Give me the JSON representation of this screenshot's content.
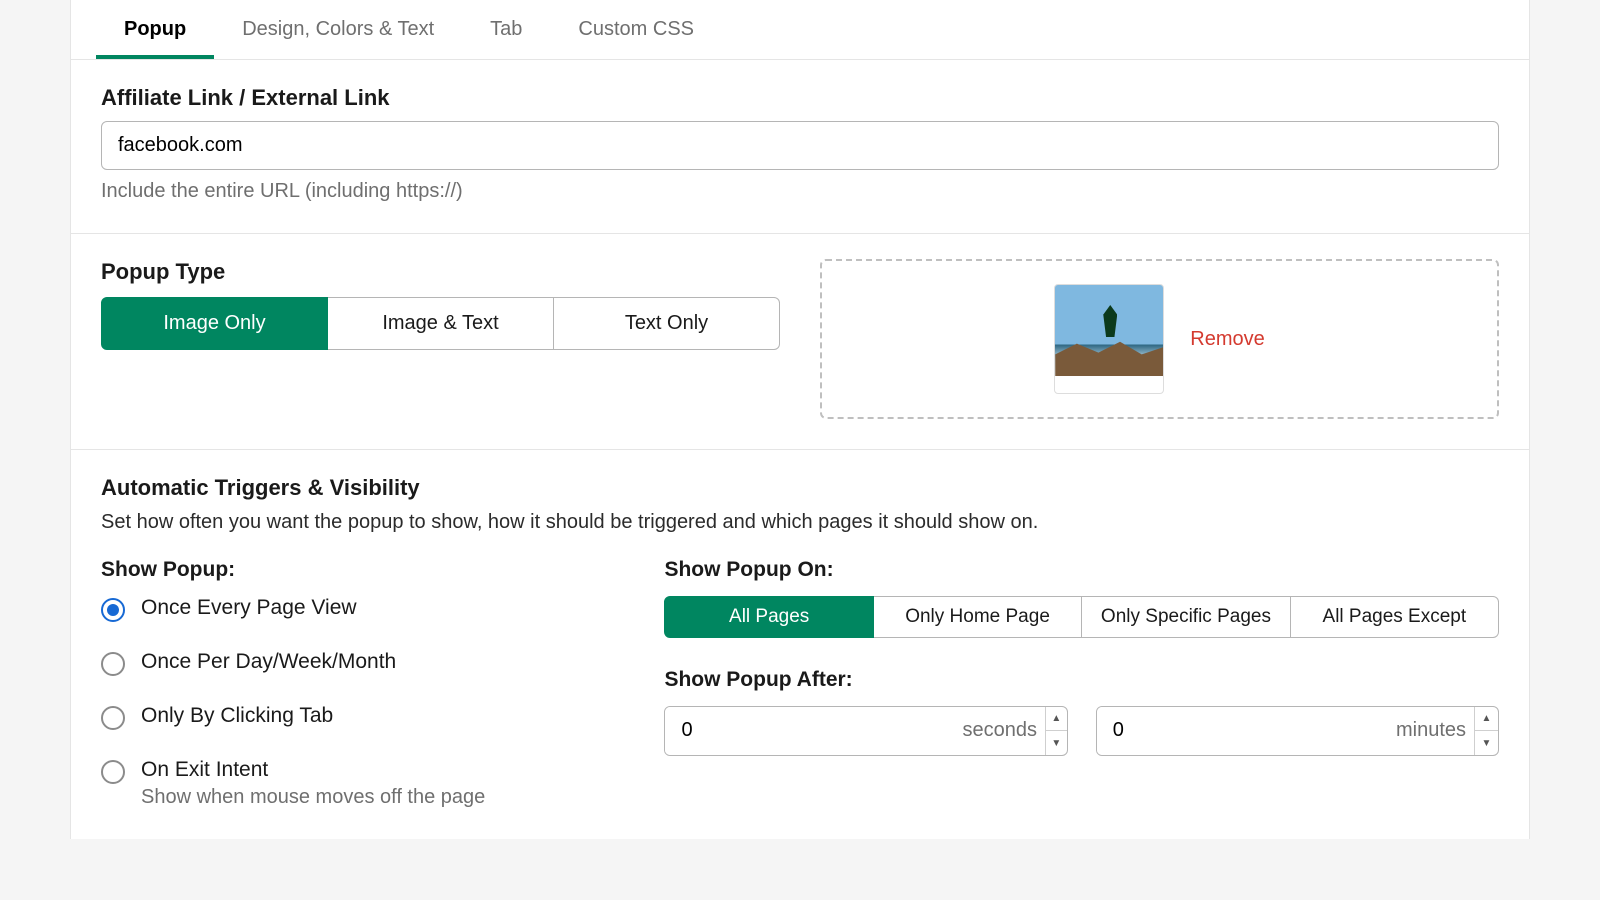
{
  "tabs": {
    "popup": "Popup",
    "design": "Design, Colors & Text",
    "tab": "Tab",
    "css": "Custom CSS"
  },
  "affiliate": {
    "label": "Affiliate Link / External Link",
    "value": "facebook.com",
    "help": "Include the entire URL (including https://)"
  },
  "popup_type": {
    "label": "Popup Type",
    "options": {
      "imageOnly": "Image Only",
      "imageText": "Image & Text",
      "textOnly": "Text Only"
    },
    "remove": "Remove"
  },
  "triggers": {
    "title": "Automatic Triggers & Visibility",
    "sub": "Set how often you want the popup to show, how it should be triggered and which pages it should show on."
  },
  "show_popup": {
    "label": "Show Popup:",
    "once_page": "Once Every Page View",
    "once_per": "Once Per Day/Week/Month",
    "only_tab": "Only By Clicking Tab",
    "exit": "On Exit Intent",
    "exit_sub": "Show when mouse moves off the page"
  },
  "show_on": {
    "label": "Show Popup On:",
    "all": "All Pages",
    "home": "Only Home Page",
    "specific": "Only Specific Pages",
    "except": "All Pages Except"
  },
  "after": {
    "label": "Show Popup After:",
    "seconds_value": "0",
    "seconds_unit": "seconds",
    "minutes_value": "0",
    "minutes_unit": "minutes"
  }
}
